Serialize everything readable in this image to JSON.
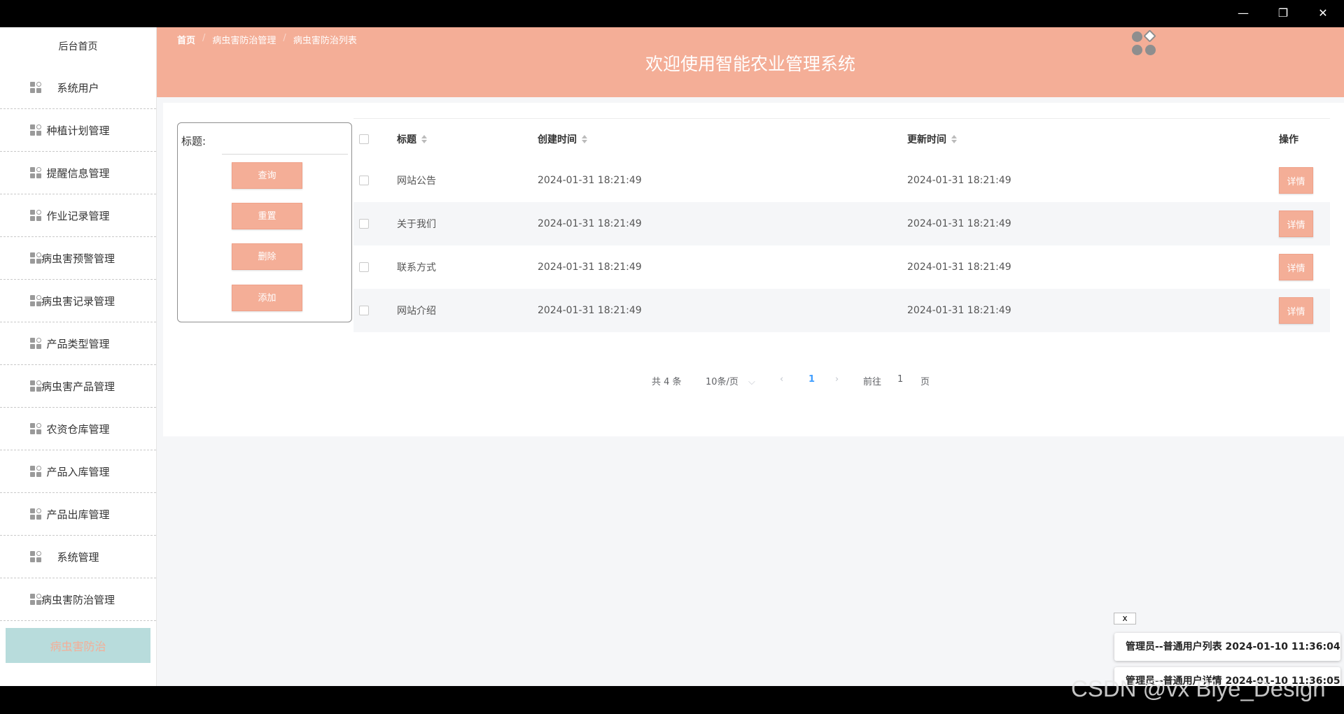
{
  "window": {
    "minimize": "—",
    "restore": "❐",
    "close": "✕"
  },
  "sidebar": {
    "home": "后台首页",
    "items": [
      {
        "label": "系统用户"
      },
      {
        "label": "种植计划管理"
      },
      {
        "label": "提醒信息管理"
      },
      {
        "label": "作业记录管理"
      },
      {
        "label": "病虫害预警管理"
      },
      {
        "label": "病虫害记录管理"
      },
      {
        "label": "产品类型管理"
      },
      {
        "label": "病虫害产品管理"
      },
      {
        "label": "农资仓库管理"
      },
      {
        "label": "产品入库管理"
      },
      {
        "label": "产品出库管理"
      },
      {
        "label": "系统管理"
      },
      {
        "label": "病虫害防治管理"
      }
    ],
    "active": "病虫害防治"
  },
  "header": {
    "breadcrumb": [
      "首页",
      "病虫害防治管理",
      "病虫害防治列表"
    ],
    "title": "欢迎使用智能农业管理系统"
  },
  "search": {
    "label": "标题:",
    "value": "",
    "buttons": {
      "query": "查询",
      "reset": "重置",
      "delete": "删除",
      "add": "添加"
    }
  },
  "table": {
    "headers": {
      "title": "标题",
      "created": "创建时间",
      "updated": "更新时间",
      "action": "操作"
    },
    "rows": [
      {
        "title": "网站公告",
        "created": "2024-01-31 18:21:49",
        "updated": "2024-01-31 18:21:49",
        "action": "详情"
      },
      {
        "title": "关于我们",
        "created": "2024-01-31 18:21:49",
        "updated": "2024-01-31 18:21:49",
        "action": "详情"
      },
      {
        "title": "联系方式",
        "created": "2024-01-31 18:21:49",
        "updated": "2024-01-31 18:21:49",
        "action": "详情"
      },
      {
        "title": "网站介绍",
        "created": "2024-01-31 18:21:49",
        "updated": "2024-01-31 18:21:49",
        "action": "详情"
      }
    ]
  },
  "pagination": {
    "total": "共 4 条",
    "page_size": "10条/页",
    "current": "1",
    "goto_prefix": "前往",
    "goto_value": "1",
    "goto_suffix": "页"
  },
  "floating_tabs": {
    "close": "x",
    "items": [
      "管理员--普通用户列表 2024-01-10 11:36:04",
      "管理员--普通用户详情 2024-01-10 11:36:05"
    ]
  },
  "watermark": "CSDN @vx Biye_Design",
  "colors": {
    "accent": "#f4ae97",
    "active_bg": "#b8dcdc",
    "page_bg": "#f5f6f8"
  }
}
